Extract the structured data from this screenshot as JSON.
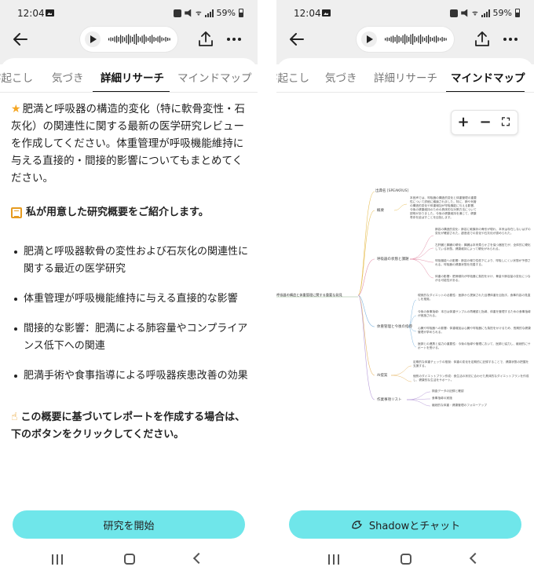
{
  "status": {
    "time": "12:04",
    "battery": "59%"
  },
  "colors": {
    "accent": "#6fe6ea",
    "star": "#f5a623",
    "doc": "#e69b20"
  },
  "left": {
    "tabs": [
      "字起こし",
      "気づき",
      "詳細リサーチ",
      "マインドマップ"
    ],
    "active_tab": "詳細リサーチ",
    "query": "肥満と呼吸器の構造的変化（特に軟骨変性・石灰化）の関連性に関する最新の医学研究レビューを作成してください。体重管理が呼吸機能維持に与える直接的・間接的影響についてもまとめてください。",
    "intro": "私が用意した研究概要をご紹介します。",
    "points": [
      "肥満と呼吸器軟骨の変性および石灰化の関連性に関する最近の医学研究",
      "体重管理が呼吸機能維持に与える直接的な影響",
      "間接的な影響：肥満による肺容量やコンプライアンス低下への関連",
      "肥満手術や食事指導による呼吸器疾患改善の効果"
    ],
    "cta": "この概要に基づいてレポートを作成する場合は、下のボタンをクリックしてください。",
    "button": "研究を開始"
  },
  "right": {
    "tabs": [
      "字起こし",
      "気づき",
      "詳細リサーチ",
      "マインドマップ"
    ],
    "active_tab": "マインドマップ",
    "zoom": {
      "plus": "+",
      "minus": "−",
      "fit": "⛶"
    },
    "mindmap": {
      "root": "呼吸器の構造と体重管理に関する重要な発見",
      "branches": [
        {
          "label": "出典名 [SPEAKRUS]",
          "nodes": []
        },
        {
          "label": "概要",
          "nodes": [
            "本音声では、呼吸器の構造的変化と体重管理の重要性について詳細に議論されました。特に、肺や気管の構造的変化や体重増加が呼吸機能に与える影響、今後の健康維持のための具体的な対策方法について説明がありました。今後の健康維持を通じて、健康寿命を延ばすことを目指します。"
          ]
        },
        {
          "label": "呼吸器の状態と課題",
          "nodes": [
            "肺容の構造的変化：肺容に軟膜状の骨形が現れ、本来は存在しないはずの変化が確認された。超音波での変化や石灰化が認められた。",
            "左肝臓と膵臓の硬化：膵臓は本来柔らかさを保つ器官だが、全体的に硬化している状態。健康維持によって硬化がみられる。",
            "呼吸機能への影響：肺容の弾力性低下により、呼吸しにくい状態が予想される。呼吸器の健康状態を改善する。",
            "体重の影響：肥満傾向が呼吸器に負担をかけ、骨量や肺容量の変化につながる可能性がある。"
          ]
        },
        {
          "label": "体重管理と今後の指導",
          "nodes": [
            "現実的なダイエットの必要性：医師から提案された目標体重を目指す。食事内容の見直しを推奨。",
            "今後の食事指導：本日は体重サンプルの再確認と指導、体重を管理するための食事指導が実施される。",
            "心臓や呼吸器への影響：体重増加は心臓や呼吸器にも負担をかけるため、長期的な健康管理が求められる。",
            "医師との連携と協力の重要性：今後の指導や管理において、医師と協力し、継続的にサポートを受ける。"
          ]
        },
        {
          "label": "AI提案",
          "nodes": [
            "定期的な体重チェックの推奨：体重の変化を定期的に記録することで、健康状態の把握を支援する。",
            "個別のダイエットプラン作成：食生活の状況に合わせた具体的なダイエットプランを作成し、健康的な生活をサポート。"
          ]
        },
        {
          "label": "作業事項リスト",
          "nodes": [
            "検査データの記録と確認",
            "食事指導の実施",
            "継続的な体重・健康管理のフォローアップ"
          ]
        }
      ]
    },
    "button": "Shadowとチャット"
  }
}
